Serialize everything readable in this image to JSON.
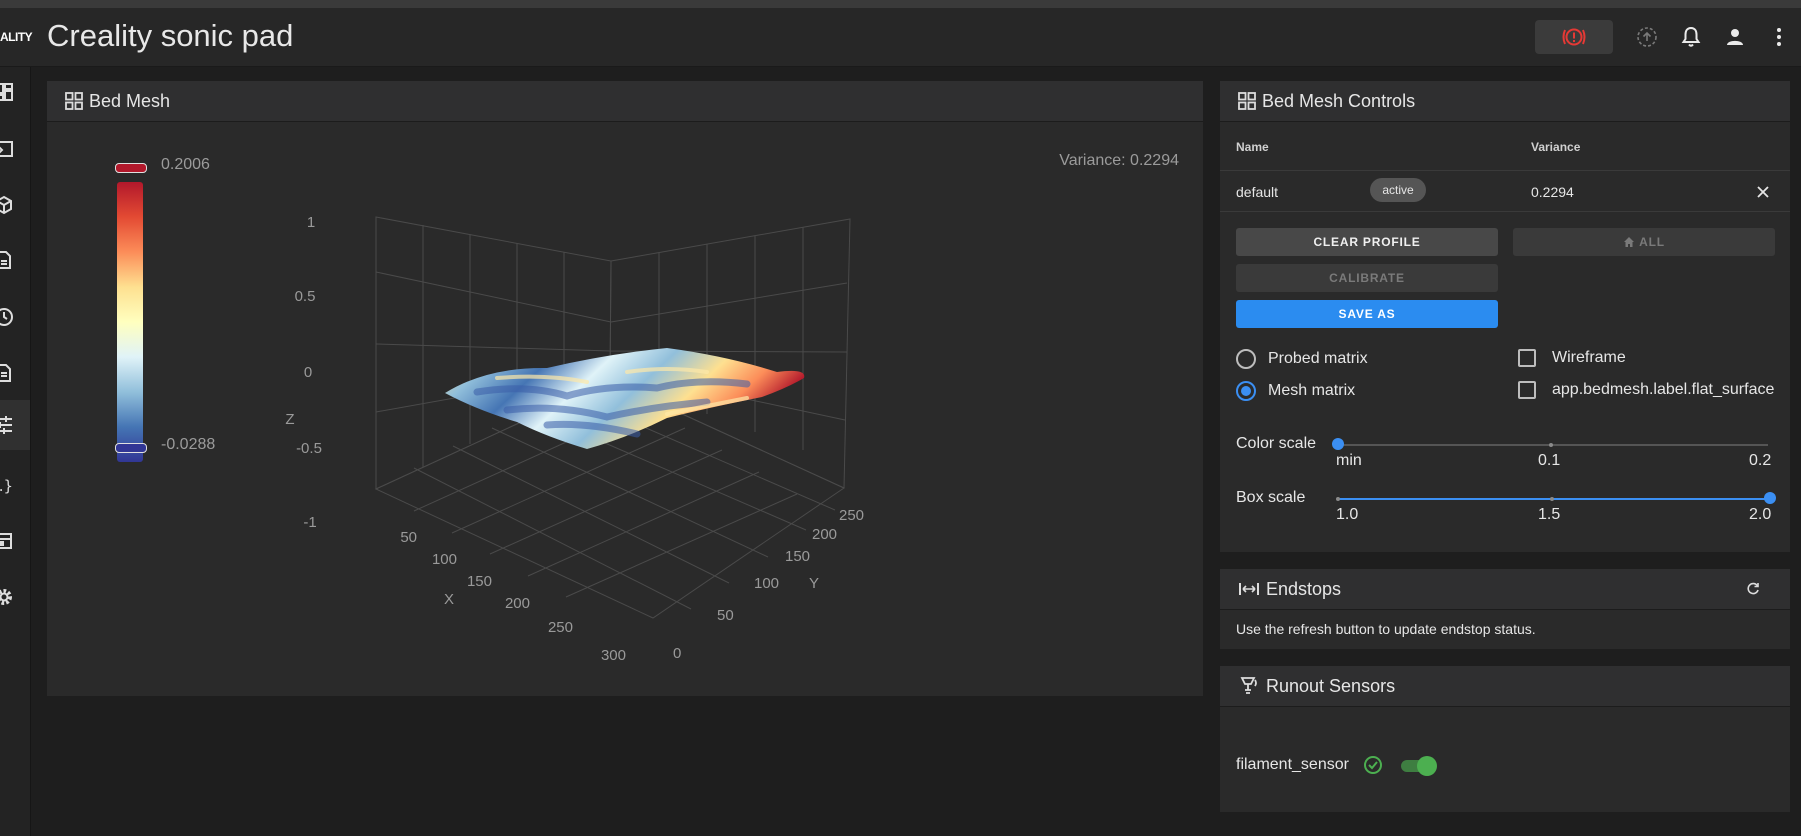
{
  "app": {
    "brand": "ALITY",
    "title": "Creality sonic pad"
  },
  "topbar": {
    "icons": [
      "emergency-stop-icon",
      "upload-icon",
      "bell-icon",
      "account-icon",
      "more-vert-icon"
    ]
  },
  "sidebar": {
    "items": [
      "dashboard-icon",
      "console-icon",
      "heightmap-icon",
      "files-icon",
      "history-icon",
      "document-icon",
      "tune-icon",
      "macros-icon",
      "machine-icon",
      "settings-icon"
    ],
    "active": "tune-icon"
  },
  "bed_mesh": {
    "title": "Bed Mesh",
    "scale_max": "0.2006",
    "scale_min": "-0.0288",
    "variance_text": "Variance: 0.2294",
    "z_ticks": [
      "1",
      "0.5",
      "0",
      "-0.5",
      "-1"
    ],
    "z_axis": "Z",
    "x_ticks": [
      "50",
      "100",
      "150",
      "200",
      "250",
      "300"
    ],
    "x_axis": "X",
    "y_ticks": [
      "0",
      "50",
      "100",
      "150",
      "200",
      "250"
    ],
    "y_axis": "Y"
  },
  "controls": {
    "title": "Bed Mesh Controls",
    "col_name": "Name",
    "col_variance": "Variance",
    "profile": {
      "name": "default",
      "status": "active",
      "variance": "0.2294"
    },
    "buttons": {
      "clear_profile": "CLEAR PROFILE",
      "home_all": "ALL",
      "calibrate": "CALIBRATE",
      "save_as": "SAVE AS"
    },
    "radios": {
      "probed": "Probed matrix",
      "mesh": "Mesh matrix"
    },
    "selected_matrix": "mesh",
    "checkboxes": {
      "wireframe": "Wireframe",
      "flat_surface": "app.bedmesh.label.flat_surface"
    },
    "color_scale": {
      "label": "Color scale",
      "ticks": [
        "min",
        "0.1",
        "0.2"
      ],
      "value_fraction": 0.0
    },
    "box_scale": {
      "label": "Box scale",
      "ticks": [
        "1.0",
        "1.5",
        "2.0"
      ],
      "value_fraction": 1.0
    }
  },
  "endstops": {
    "title": "Endstops",
    "text": "Use the refresh button to update endstop status."
  },
  "runout": {
    "title": "Runout Sensors",
    "sensor_name": "filament_sensor",
    "enabled": true
  },
  "colors": {
    "accent": "#2b8cf0",
    "emergency": "#e53935",
    "success": "#4caf50"
  }
}
